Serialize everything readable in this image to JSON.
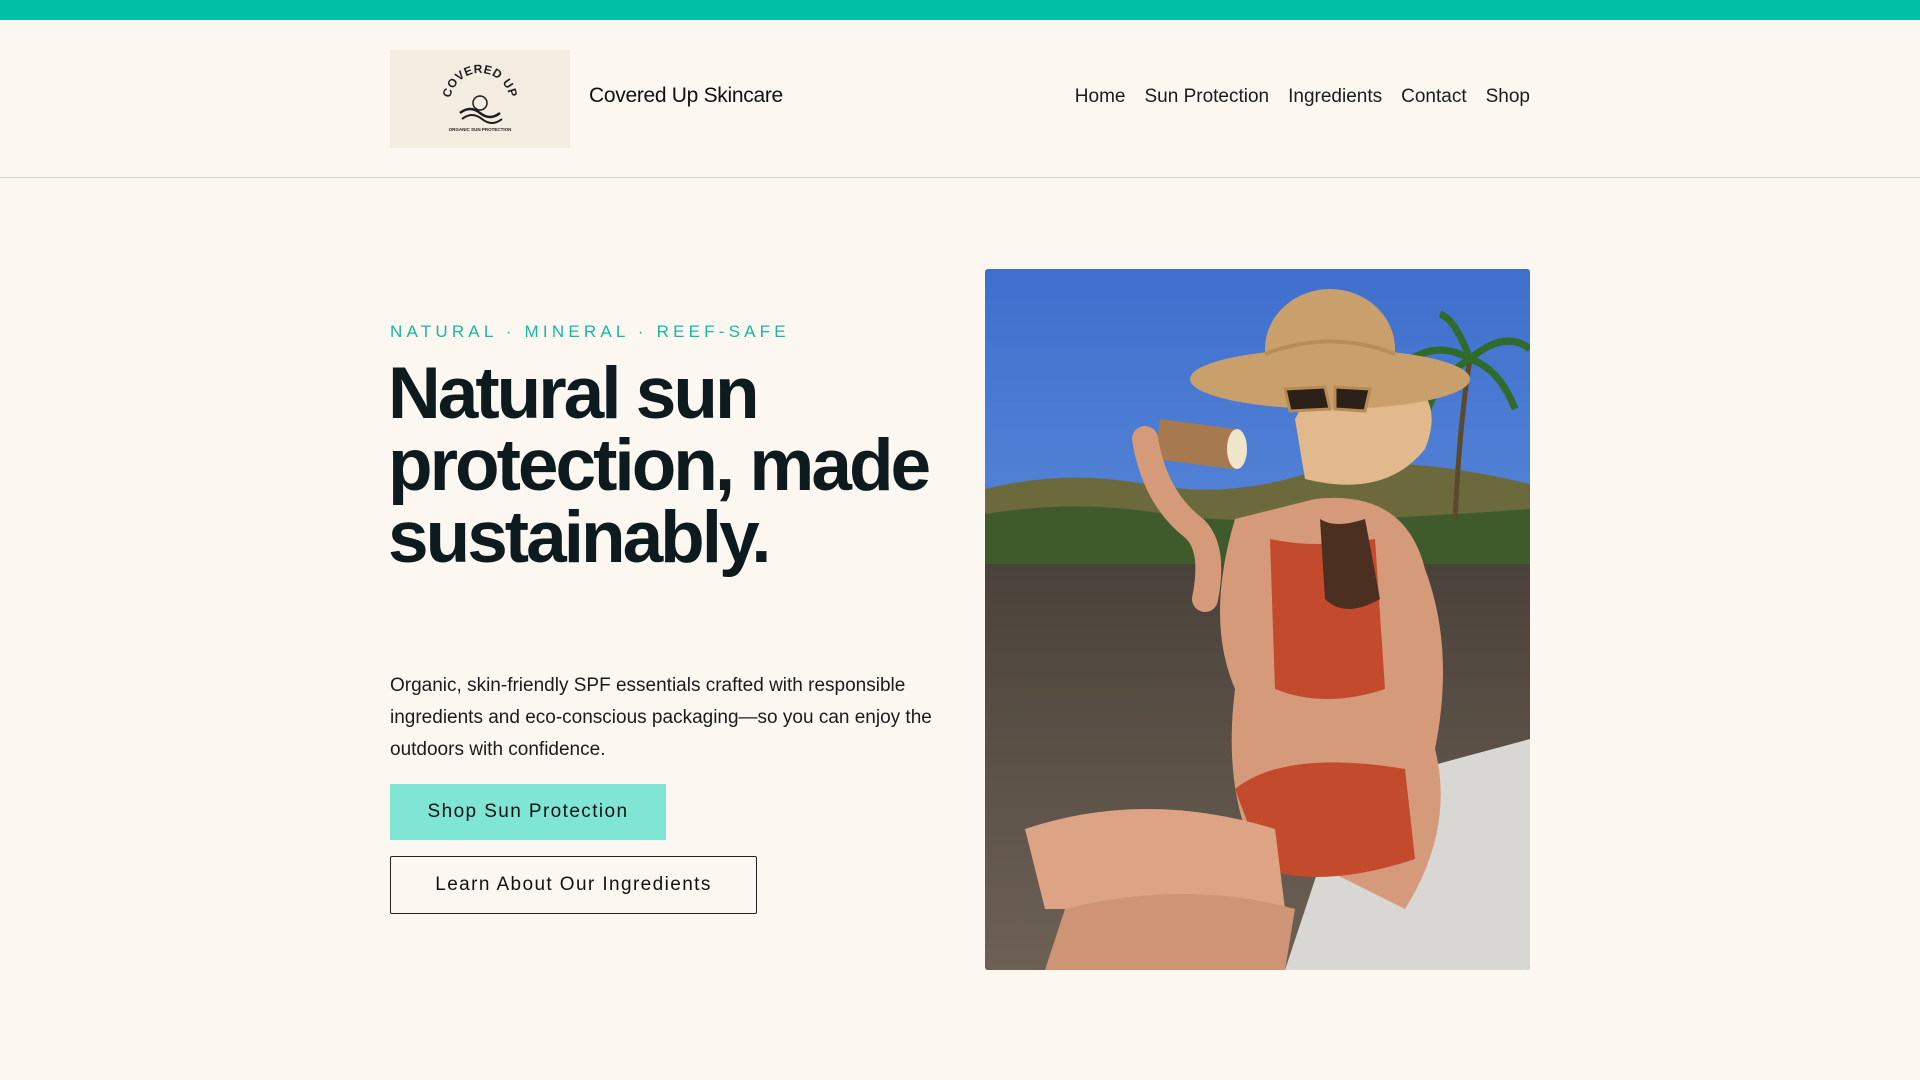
{
  "colors": {
    "accent": "#00bfa5",
    "button": "#7fe6d6",
    "background": "#fdf7f2",
    "text": "#0e1b1e"
  },
  "header": {
    "logo": {
      "line1": "COVERED UP",
      "line2": "ORGANIC SUN PROTECTION"
    },
    "brand_name": "Covered Up Skincare",
    "nav": [
      "Home",
      "Sun Protection",
      "Ingredients",
      "Contact",
      "Shop"
    ]
  },
  "hero": {
    "eyebrow": "NATURAL · MINERAL · REEF-SAFE",
    "headline": "Natural sun protection, made sustainably.",
    "subtext": "Organic, skin-friendly SPF essentials crafted with responsible ingredients and eco-conscious packaging—so you can enjoy the outdoors with confidence.",
    "primary_button": "Shop Sun Protection",
    "secondary_button": "Learn About Our Ingredients"
  }
}
